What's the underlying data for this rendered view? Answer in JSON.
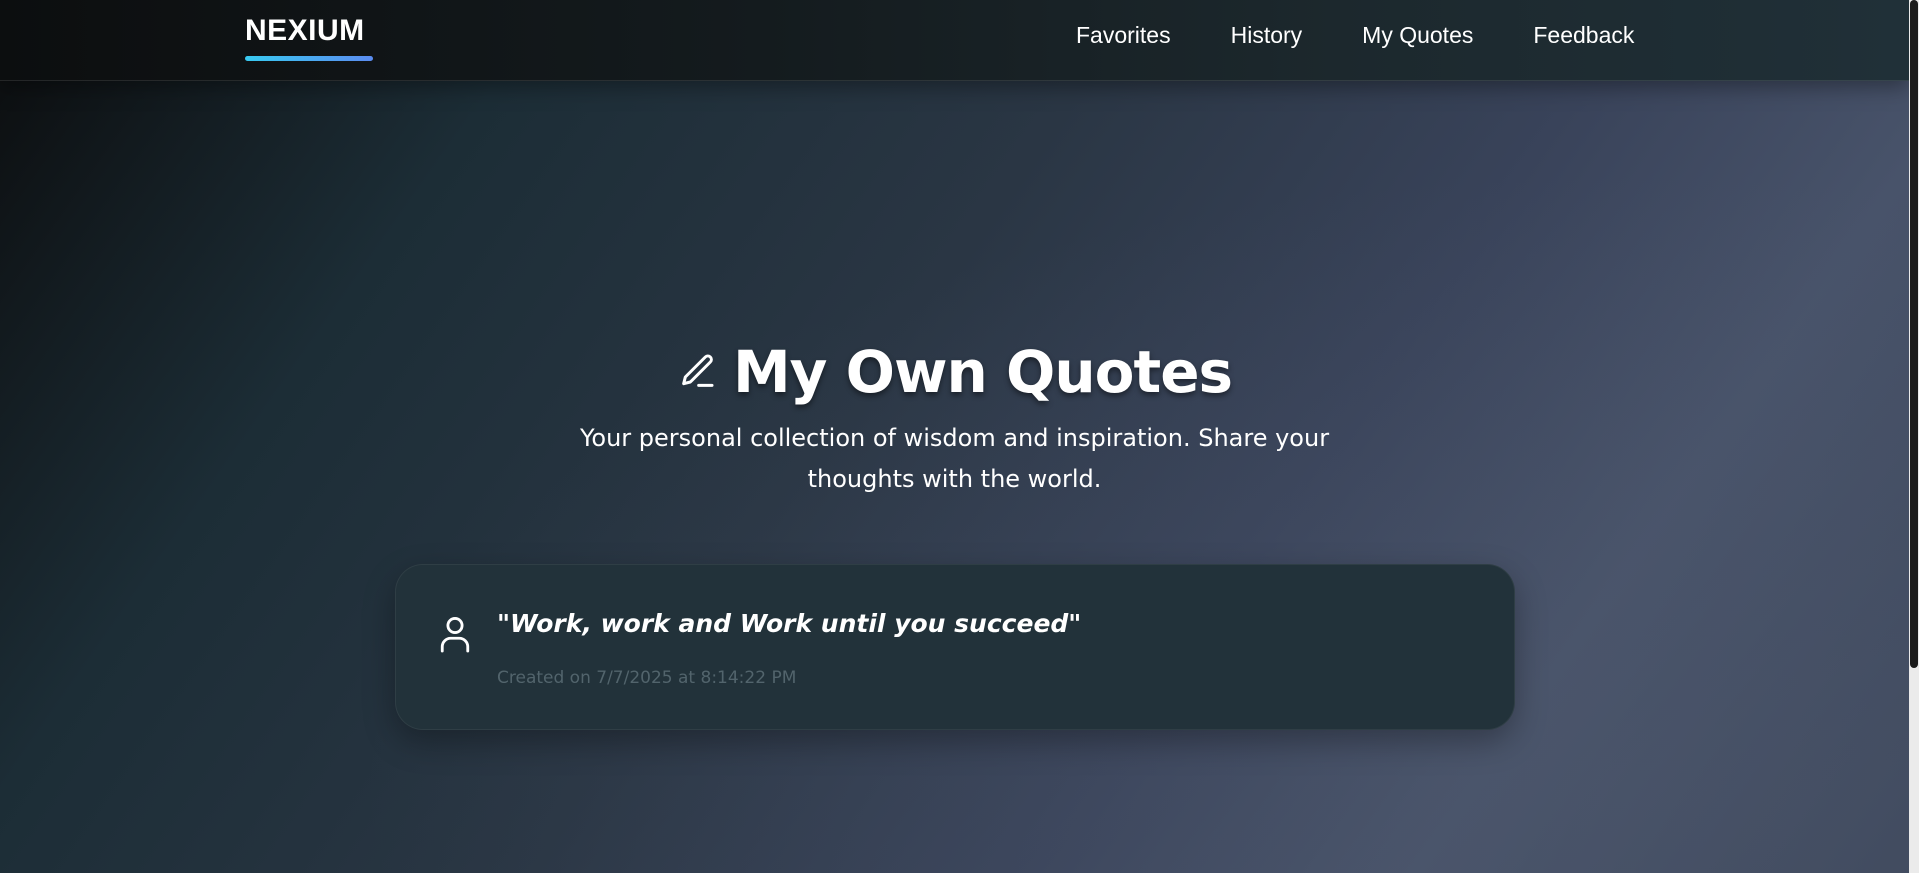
{
  "nav": {
    "logo": "NEXIUM",
    "links": [
      "Favorites",
      "History",
      "My Quotes",
      "Feedback"
    ]
  },
  "hero": {
    "title": "My Own Quotes",
    "subtitle": "Your personal collection of wisdom and inspiration. Share your thoughts with the world.",
    "title_icon": "pencil-icon"
  },
  "quotes": [
    {
      "text": "\"Work, work and Work until you succeed\"",
      "meta": "Created on 7/7/2025 at 8:14:22 PM",
      "icon": "user-icon"
    }
  ],
  "colors": {
    "accent_gradient_start": "#38c9f0",
    "accent_gradient_end": "#5b8cf0",
    "card_background": "#22323a",
    "meta_text": "#52646c"
  }
}
